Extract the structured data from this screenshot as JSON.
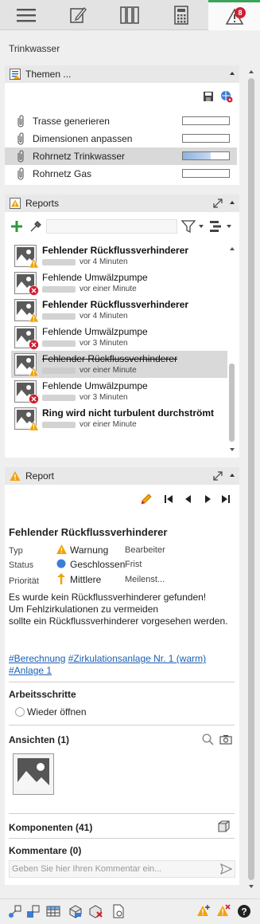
{
  "toolbar": {
    "tabs": [
      {
        "name": "menu-icon"
      },
      {
        "name": "edit-icon"
      },
      {
        "name": "library-icon"
      },
      {
        "name": "calculator-icon"
      },
      {
        "name": "warning-icon"
      }
    ],
    "badge_count": "8",
    "accent": "#3aa55a"
  },
  "page_title": "Trinkwasser",
  "themes": {
    "header": "Themen ...",
    "items": [
      {
        "label": "Trasse generieren",
        "progress": 0
      },
      {
        "label": "Dimensionen anpassen",
        "progress": 0
      },
      {
        "label": "Rohrnetz Trinkwasser",
        "progress": 0.6,
        "selected": true
      },
      {
        "label": "Rohrnetz Gas",
        "progress": 0
      }
    ]
  },
  "reports": {
    "header": "Reports",
    "items": [
      {
        "title": "Fehlender Rückflussverhinderer",
        "time": "vor 4 Minuten",
        "bold": true,
        "severity": "warning"
      },
      {
        "title": "Fehlende Umwälzpumpe",
        "time": "vor einer Minute",
        "bold": false,
        "severity": "error"
      },
      {
        "title": "Fehlender Rückflussverhinderer",
        "time": "vor 4 Minuten",
        "bold": true,
        "severity": "warning"
      },
      {
        "title": "Fehlende Umwälzpumpe",
        "time": "vor 3 Minuten",
        "bold": false,
        "severity": "error"
      },
      {
        "title": "Fehlender Rückflussverhinderer",
        "time": "vor einer Minute",
        "bold": false,
        "strike": true,
        "selected": true,
        "severity": "warning"
      },
      {
        "title": "Fehlende Umwälzpumpe",
        "time": "vor 3 Minuten",
        "bold": false,
        "severity": "error"
      },
      {
        "title": "Ring wird nicht turbulent durchströmt",
        "time": "vor einer Minute",
        "bold": true,
        "severity": "warning"
      }
    ]
  },
  "report": {
    "header": "Report",
    "title": "Fehlender Rückflussverhinderer",
    "typ_label": "Typ",
    "typ_value": "Warnung",
    "status_label": "Status",
    "status_value": "Geschlossen",
    "prioritaet_label": "Priorität",
    "prioritaet_value": "Mittlere",
    "bearbeiter_label": "Bearbeiter",
    "frist_label": "Frist",
    "meilenstein_label": "Meilenst...",
    "description_1": "Es wurde kein Rückflussverhinderer gefunden!",
    "description_2": "Um Fehlzirkulationen zu vermeiden",
    "description_3": "sollte ein Rückflussverhinderer vorgesehen werden.",
    "tags": [
      "#Berechnung",
      "#Zirkulationsanlage Nr. 1 (warm)",
      "#Anlage 1"
    ],
    "arbeitsschritte_label": "Arbeitsschritte",
    "wieder_oeffnen": "Wieder öffnen",
    "ansichten_label": "Ansichten (1)",
    "komponenten_label": "Komponenten (41)",
    "kommentare_label": "Kommentare (0)",
    "comment_placeholder": "Geben Sie hier Ihren Kommentar ein..."
  }
}
